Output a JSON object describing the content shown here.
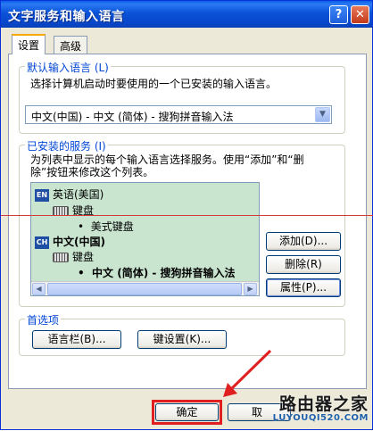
{
  "window": {
    "title": "文字服务和输入语言",
    "help_label": "?",
    "close_label": "✕"
  },
  "tabs": [
    {
      "label": "设置",
      "active": true
    },
    {
      "label": "高级",
      "active": false
    }
  ],
  "default_lang": {
    "group_label": "默认输入语言 (L)",
    "description": "选择计算机启动时要使用的一个已安装的输入语言。",
    "selected_value": "中文(中国) - 中文 (简体) - 搜狗拼音输入法"
  },
  "installed_services": {
    "group_label": "已安装的服务 (I)",
    "description_line1": "为列表中显示的每个输入语言选择服务。使用“添加”和“删",
    "description_line2": "除”按钮来修改这个列表。",
    "tree": [
      {
        "icon": "EN",
        "label": "英语(美国)",
        "bold": false
      },
      {
        "label": "键盘"
      },
      {
        "label": "美式键盘"
      },
      {
        "icon": "CH",
        "label": "中文(中国)",
        "bold": true
      },
      {
        "label": "键盘"
      },
      {
        "label": "中文 (简体) - 搜狗拼音输入法",
        "bold": true
      }
    ],
    "buttons": {
      "add": "添加(D)...",
      "remove": "删除(R)",
      "properties": "属性(P)..."
    }
  },
  "preferences": {
    "group_label": "首选项",
    "language_bar": "语言栏(B)...",
    "key_settings": "键设置(K)..."
  },
  "footer": {
    "ok": "确定",
    "cancel_partial": "取"
  },
  "watermark": {
    "line1": "路由器之家",
    "line2": "LUYOUQI520.COM"
  },
  "colors": {
    "title_bar": "#0a52d8",
    "group_label": "#0046d5",
    "tree_background": "#c9e4cf",
    "highlight": "#e02020"
  }
}
